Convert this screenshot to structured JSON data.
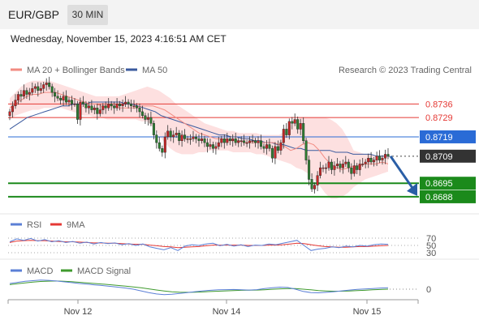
{
  "header": {
    "symbol": "EUR/GBP",
    "timeframe": "30 MIN",
    "datetime": "Wednesday, November 15, 2023 4:16:51 AM CET",
    "credit": "Research © 2023 Trading Central"
  },
  "legend": {
    "bollinger": "MA 20 + Bollinger Bands",
    "ma50": "MA 50",
    "rsi": "RSI",
    "rsi_ma": "9MA",
    "macd": "MACD",
    "macd_signal": "MACD Signal"
  },
  "colors": {
    "ma20": "#f28b82",
    "band_fill": "#fde0e0",
    "ma50": "#3a5a9e",
    "up_candle": "#c62828",
    "down_candle": "#2e7d32",
    "resistance": "#e53935",
    "current_level": "#2a6bd6",
    "support": "#1b8a1b",
    "arrow": "#2a5ea6",
    "rsi": "#5b7fd6",
    "rsi_ma": "#e53935",
    "macd": "#5b7fd6",
    "macd_signal": "#3f9a2e"
  },
  "chart_data": [
    {
      "type": "candlestick",
      "x_ticks": [
        "Nov 12",
        "Nov 14",
        "Nov 15"
      ],
      "ylim": [
        0.868,
        0.875
      ],
      "current_price": 0.8709,
      "levels": [
        {
          "value": "0.8736",
          "kind": "resistance"
        },
        {
          "value": "0.8729",
          "kind": "resistance"
        },
        {
          "value": "0.8719",
          "kind": "pivot"
        },
        {
          "value": "0.8709",
          "kind": "current"
        },
        {
          "value": "0.8695",
          "kind": "support"
        },
        {
          "value": "0.8688",
          "kind": "support"
        }
      ],
      "forecast": {
        "from": 0.8709,
        "to": 0.8688,
        "direction": "down"
      },
      "close": [
        0.8732,
        0.8735,
        0.8738,
        0.8741,
        0.874,
        0.8743,
        0.8741,
        0.8742,
        0.8744,
        0.8745,
        0.8743,
        0.8744,
        0.8746,
        0.8747,
        0.8745,
        0.8742,
        0.874,
        0.8739,
        0.8738,
        0.874,
        0.8737,
        0.8738,
        0.8736,
        0.8736,
        0.8728,
        0.8737,
        0.8736,
        0.8734,
        0.8735,
        0.8733,
        0.8734,
        0.8731,
        0.8733,
        0.8735,
        0.8734,
        0.8736,
        0.8735,
        0.8734,
        0.8736,
        0.8735,
        0.8736,
        0.8737,
        0.8736,
        0.8735,
        0.8735,
        0.8734,
        0.8732,
        0.873,
        0.8728,
        0.8729,
        0.8726,
        0.872,
        0.8716,
        0.8713,
        0.8711,
        0.8719,
        0.8722,
        0.8719,
        0.872,
        0.8721,
        0.8717,
        0.872,
        0.8718,
        0.8718,
        0.8718,
        0.8719,
        0.8718,
        0.8717,
        0.8718,
        0.8716,
        0.8714,
        0.8715,
        0.8713,
        0.8714,
        0.8716,
        0.8718,
        0.8716,
        0.8718,
        0.8717,
        0.8718,
        0.8716,
        0.8717,
        0.8717,
        0.8716,
        0.8716,
        0.8717,
        0.8717,
        0.8716,
        0.8717,
        0.8714,
        0.8713,
        0.8715,
        0.8713,
        0.8708,
        0.8714,
        0.8712,
        0.8716,
        0.8723,
        0.872,
        0.8727,
        0.8726,
        0.8728,
        0.8723,
        0.8726,
        0.8717,
        0.8707,
        0.8697,
        0.8692,
        0.8694,
        0.8699,
        0.8703,
        0.8703,
        0.8703,
        0.8706,
        0.8702,
        0.8704,
        0.8705,
        0.8703,
        0.8705,
        0.8706,
        0.8703,
        0.87,
        0.8704,
        0.8702,
        0.8705,
        0.8705,
        0.8706,
        0.8708,
        0.8706,
        0.8707,
        0.8709,
        0.8707,
        0.8708,
        0.871,
        0.8709
      ],
      "ma20": [
        0.8734,
        0.8736,
        0.8738,
        0.874,
        0.8741,
        0.8741,
        0.8742,
        0.8742,
        0.8742,
        0.8741,
        0.874,
        0.8739,
        0.8738,
        0.8737,
        0.8736,
        0.8736,
        0.8735,
        0.8735,
        0.8735,
        0.8734,
        0.8734,
        0.8734,
        0.8734,
        0.8735,
        0.8735,
        0.8735,
        0.8734,
        0.8733,
        0.8731,
        0.8729,
        0.8727,
        0.8725,
        0.8723,
        0.8721,
        0.872,
        0.8719,
        0.8718,
        0.8718,
        0.8717,
        0.8717,
        0.8717,
        0.8716,
        0.8716,
        0.8716,
        0.8716,
        0.8716,
        0.8716,
        0.8715,
        0.8714,
        0.8712,
        0.8713,
        0.8715,
        0.8716,
        0.8715,
        0.8712,
        0.8708,
        0.8705,
        0.8703,
        0.8702,
        0.8703,
        0.8704,
        0.8704,
        0.8705,
        0.8705,
        0.8705,
        0.8706,
        0.8705
      ],
      "bb_upper": [
        0.8739,
        0.8742,
        0.8745,
        0.8747,
        0.8748,
        0.8748,
        0.8748,
        0.8748,
        0.8747,
        0.8746,
        0.8745,
        0.8744,
        0.8743,
        0.8742,
        0.8741,
        0.874,
        0.874,
        0.874,
        0.874,
        0.874,
        0.8741,
        0.8742,
        0.8743,
        0.8744,
        0.8745,
        0.8744,
        0.8743,
        0.8741,
        0.8739,
        0.8736,
        0.8734,
        0.8732,
        0.873,
        0.8728,
        0.8726,
        0.8725,
        0.8724,
        0.8723,
        0.8722,
        0.8722,
        0.8721,
        0.8721,
        0.8721,
        0.8721,
        0.872,
        0.872,
        0.872,
        0.872,
        0.8722,
        0.8725,
        0.8728,
        0.8729,
        0.8729,
        0.8729,
        0.8729,
        0.8729,
        0.8728,
        0.8726,
        0.8723,
        0.8718,
        0.8712,
        0.8711,
        0.871,
        0.871,
        0.8709,
        0.8709,
        0.8709
      ],
      "bb_lower": [
        0.8728,
        0.873,
        0.8731,
        0.8732,
        0.8733,
        0.8733,
        0.8734,
        0.8734,
        0.8734,
        0.8734,
        0.8733,
        0.8732,
        0.8731,
        0.873,
        0.873,
        0.8729,
        0.8729,
        0.8728,
        0.8728,
        0.8728,
        0.8728,
        0.8728,
        0.8728,
        0.8727,
        0.8727,
        0.8724,
        0.872,
        0.8716,
        0.8713,
        0.8711,
        0.871,
        0.871,
        0.871,
        0.8711,
        0.8711,
        0.8712,
        0.8712,
        0.8712,
        0.8712,
        0.8711,
        0.8711,
        0.8711,
        0.8711,
        0.871,
        0.871,
        0.8709,
        0.8708,
        0.8707,
        0.8706,
        0.8705,
        0.8703,
        0.8702,
        0.87,
        0.8697,
        0.8694,
        0.869,
        0.8687,
        0.8687,
        0.8688,
        0.869,
        0.8693,
        0.8695,
        0.8697,
        0.8698,
        0.8699,
        0.87,
        0.8701
      ],
      "ma50": [
        0.8723,
        0.8725,
        0.8727,
        0.8729,
        0.873,
        0.8731,
        0.8732,
        0.8733,
        0.8734,
        0.8735,
        0.8735,
        0.8736,
        0.8736,
        0.8736,
        0.8737,
        0.8737,
        0.8737,
        0.8737,
        0.8737,
        0.8737,
        0.8736,
        0.8736,
        0.8735,
        0.8734,
        0.8733,
        0.8732,
        0.873,
        0.8729,
        0.8728,
        0.8727,
        0.8726,
        0.8725,
        0.8724,
        0.8723,
        0.8722,
        0.8721,
        0.872,
        0.872,
        0.8719,
        0.8719,
        0.8718,
        0.8718,
        0.8717,
        0.8717,
        0.8716,
        0.8716,
        0.8715,
        0.8715,
        0.8714,
        0.8713,
        0.8713,
        0.8712,
        0.8712,
        0.8712,
        0.8712,
        0.8712,
        0.8711,
        0.8711,
        0.8711,
        0.871,
        0.871,
        0.871,
        0.871,
        0.8709,
        0.8709,
        0.8709
      ]
    },
    {
      "type": "line",
      "title": "RSI",
      "y_ticks": [
        "70",
        "50",
        "30"
      ],
      "series": [
        {
          "name": "RSI",
          "values": [
            60,
            68,
            64,
            69,
            62,
            66,
            60,
            63,
            58,
            61,
            56,
            59,
            54,
            58,
            55,
            57,
            52,
            55,
            50,
            54,
            46,
            42,
            38,
            44,
            36,
            48,
            52,
            50,
            54,
            56,
            49,
            53,
            48,
            52,
            47,
            51,
            50,
            54,
            52,
            56,
            60,
            64,
            50,
            36,
            40,
            42,
            46,
            44,
            48,
            46,
            50,
            48,
            52,
            54,
            53
          ]
        },
        {
          "name": "9MA",
          "values": [
            58,
            62,
            63,
            64,
            63,
            63,
            62,
            61,
            60,
            60,
            59,
            58,
            57,
            57,
            56,
            56,
            55,
            54,
            53,
            53,
            51,
            49,
            47,
            46,
            44,
            45,
            46,
            47,
            49,
            51,
            51,
            51,
            51,
            51,
            50,
            50,
            50,
            51,
            51,
            52,
            54,
            56,
            55,
            52,
            49,
            47,
            46,
            45,
            45,
            46,
            47,
            47,
            48,
            49,
            50
          ]
        }
      ]
    },
    {
      "type": "line",
      "title": "MACD",
      "y_ticks": [
        "0"
      ],
      "series": [
        {
          "name": "MACD",
          "values": [
            0.5,
            0.6,
            0.7,
            0.75,
            0.8,
            0.78,
            0.72,
            0.65,
            0.58,
            0.5,
            0.44,
            0.38,
            0.32,
            0.25,
            0.18,
            0.1,
            0.0,
            -0.15,
            -0.3,
            -0.42,
            -0.48,
            -0.45,
            -0.38,
            -0.3,
            -0.22,
            -0.15,
            -0.1,
            -0.06,
            -0.04,
            -0.03,
            -0.05,
            -0.08,
            -0.04,
            0.05,
            0.12,
            0.18,
            0.15,
            0.0,
            -0.2,
            -0.3,
            -0.32,
            -0.28,
            -0.22,
            -0.15,
            -0.08,
            -0.02,
            0.02,
            0.06,
            0.1,
            0.13
          ]
        },
        {
          "name": "MACD Signal",
          "values": [
            0.4,
            0.48,
            0.56,
            0.63,
            0.68,
            0.71,
            0.72,
            0.7,
            0.66,
            0.61,
            0.56,
            0.5,
            0.45,
            0.39,
            0.33,
            0.27,
            0.2,
            0.12,
            0.03,
            -0.07,
            -0.16,
            -0.23,
            -0.27,
            -0.28,
            -0.27,
            -0.24,
            -0.21,
            -0.18,
            -0.15,
            -0.12,
            -0.1,
            -0.09,
            -0.08,
            -0.05,
            -0.01,
            0.03,
            0.06,
            0.05,
            0.0,
            -0.06,
            -0.12,
            -0.16,
            -0.18,
            -0.18,
            -0.16,
            -0.13,
            -0.1,
            -0.06,
            -0.03,
            0.0
          ]
        }
      ]
    }
  ]
}
